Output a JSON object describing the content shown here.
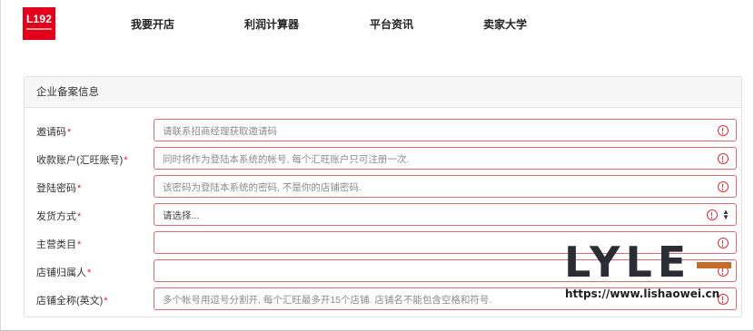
{
  "brand": {
    "logo_text": "L192"
  },
  "nav": {
    "items": [
      {
        "label": "我要开店"
      },
      {
        "label": "利润计算器"
      },
      {
        "label": "平台资讯"
      },
      {
        "label": "卖家大学"
      }
    ]
  },
  "form": {
    "title": "企业备案信息",
    "fields": [
      {
        "label": "邀请码",
        "required_mark": "*",
        "placeholder": "请联系招商经理获取邀请码",
        "value": ""
      },
      {
        "label": "收款账户(汇旺账号)",
        "required_mark": "*",
        "placeholder": "同时将作为登陆本系统的帐号, 每个汇旺账户只可注册一次.",
        "value": ""
      },
      {
        "label": "登陆密码",
        "required_mark": "*",
        "placeholder": "该密码为登陆本系统的密码, 不是你的店铺密码.",
        "value": ""
      },
      {
        "label": "发货方式",
        "required_mark": "*",
        "selected": "请选择...",
        "type": "select"
      },
      {
        "label": "主营类目",
        "required_mark": "*",
        "placeholder": "",
        "value": ""
      },
      {
        "label": "店铺归属人",
        "required_mark": "*",
        "placeholder": "",
        "value": ""
      },
      {
        "label": "店铺全称(英文)",
        "required_mark": "*",
        "placeholder": "多个帐号用逗号分割开, 每个汇旺最多开15个店铺. 店铺名不能包含空格和符号.",
        "value": ""
      }
    ]
  },
  "watermark": {
    "logo": "LYLE",
    "url": "https://www.lishaowei.cn"
  },
  "colors": {
    "brand_red": "#e4001b",
    "error_border": "#e06a74",
    "error_icon": "#d9303a",
    "watermark_accent": "#c46c2a"
  }
}
